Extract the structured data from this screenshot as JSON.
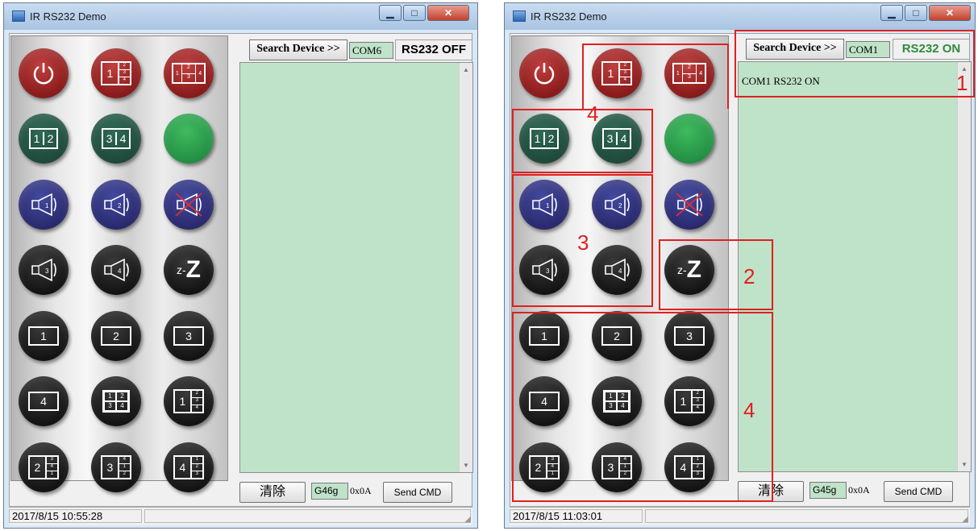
{
  "windows": [
    {
      "title": "IR RS232  Demo",
      "header": {
        "search_label": "Search Device >>",
        "com_value": "COM6",
        "rs_status": "RS232 OFF",
        "rs_status_color": "#000000"
      },
      "log_lines": [],
      "bottom": {
        "clear_label": "清除",
        "cmd_value": "G46g",
        "hex_label": "0x0A",
        "send_label": "Send CMD"
      },
      "status": {
        "datetime": "2017/8/15 10:55:28"
      }
    },
    {
      "title": "IR RS232  Demo",
      "header": {
        "search_label": "Search Device >>",
        "com_value": "COM1",
        "rs_status": "RS232 ON",
        "rs_status_color": "#2f8a3c"
      },
      "log_lines": [
        "COM1 RS232 ON"
      ],
      "bottom": {
        "clear_label": "清除",
        "cmd_value": "G45g",
        "hex_label": "0x0A",
        "send_label": "Send CMD"
      },
      "status": {
        "datetime": "2017/8/15 11:03:01"
      }
    }
  ],
  "remote_buttons": [
    {
      "name": "power-button",
      "color": "red",
      "icon": "power-icon"
    },
    {
      "name": "layout-1-234-button",
      "color": "red",
      "icon": "layout-1-plus-3-icon",
      "main": "1",
      "subs": [
        "2",
        "3",
        "4"
      ]
    },
    {
      "name": "layout-1-23-4-button",
      "color": "red",
      "icon": "layout-1-23-4-icon",
      "left": "1",
      "mid": [
        "2",
        "3"
      ],
      "right": "4"
    },
    {
      "name": "split-1-2-button",
      "color": "green",
      "icon": "split-icon",
      "cells": [
        "1",
        "2"
      ]
    },
    {
      "name": "split-3-4-button",
      "color": "green",
      "icon": "split-icon",
      "cells": [
        "3",
        "4"
      ]
    },
    {
      "name": "green-button",
      "color": "bright",
      "icon": "blank-icon"
    },
    {
      "name": "audio-1-button",
      "color": "purple",
      "icon": "speaker-icon",
      "num": "1"
    },
    {
      "name": "audio-2-button",
      "color": "purple",
      "icon": "speaker-icon",
      "num": "2"
    },
    {
      "name": "mute-button",
      "color": "purple",
      "icon": "speaker-muted-icon"
    },
    {
      "name": "audio-3-button",
      "color": "black",
      "icon": "speaker-icon",
      "num": "3"
    },
    {
      "name": "audio-4-button",
      "color": "black",
      "icon": "speaker-icon",
      "num": "4"
    },
    {
      "name": "sleep-button",
      "color": "black",
      "icon": "sleep-icon",
      "text": "z-Z"
    },
    {
      "name": "input-1-button",
      "color": "black",
      "icon": "box-icon",
      "num": "1"
    },
    {
      "name": "input-2-button",
      "color": "black",
      "icon": "box-icon",
      "num": "2"
    },
    {
      "name": "input-3-button",
      "color": "black",
      "icon": "box-icon",
      "num": "3"
    },
    {
      "name": "input-4-button",
      "color": "black",
      "icon": "box-icon",
      "num": "4"
    },
    {
      "name": "quad-button",
      "color": "black",
      "icon": "quad-icon",
      "cells": [
        "1",
        "2",
        "3",
        "4"
      ]
    },
    {
      "name": "pip-1-button",
      "color": "black",
      "icon": "layout-1-plus-3-icon",
      "main": "1",
      "subs": [
        "2",
        "3",
        "4"
      ]
    },
    {
      "name": "pip-2-button",
      "color": "black",
      "icon": "layout-1-plus-3-icon",
      "main": "2",
      "subs": [
        "3",
        "4",
        "1"
      ]
    },
    {
      "name": "pip-3-button",
      "color": "black",
      "icon": "layout-1-plus-3-icon",
      "main": "3",
      "subs": [
        "4",
        "1",
        "2"
      ]
    },
    {
      "name": "pip-4-button",
      "color": "black",
      "icon": "layout-1-plus-3-icon",
      "main": "4",
      "subs": [
        "1",
        "2",
        "3"
      ]
    }
  ],
  "annotations": [
    {
      "num": "1",
      "name": "annotation-1"
    },
    {
      "num": "2",
      "name": "annotation-2"
    },
    {
      "num": "3",
      "name": "annotation-3"
    },
    {
      "num": "4",
      "name": "annotation-4-top"
    },
    {
      "num": "4",
      "name": "annotation-4-bottom"
    }
  ]
}
